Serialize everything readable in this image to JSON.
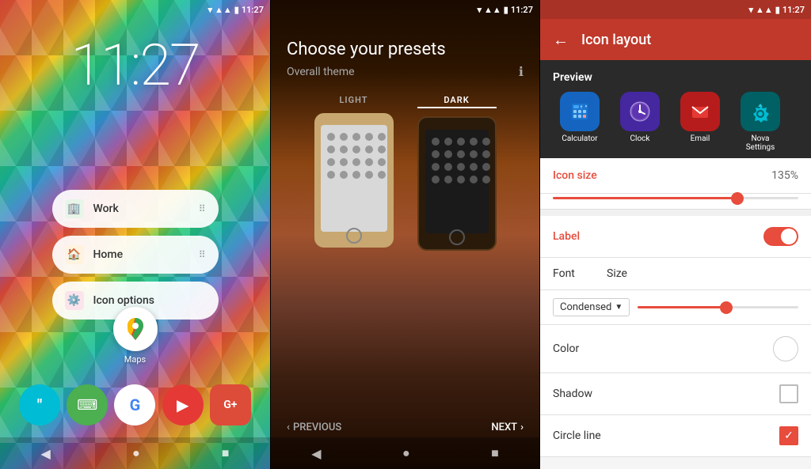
{
  "panel1": {
    "status_time": "11:27",
    "clock_time": "11:27",
    "menu_items": [
      {
        "label": "Work",
        "icon": "🏢",
        "icon_color": "#27ae60"
      },
      {
        "label": "Home",
        "icon": "🏠",
        "icon_color": "#e67e22"
      },
      {
        "label": "Icon options",
        "icon": "⚙️",
        "icon_color": "#e74c3c"
      }
    ],
    "maps_label": "Maps",
    "dock_icons": [
      "💬",
      "⌨",
      "G",
      "▶",
      "G+"
    ],
    "nav": {
      "back": "◀",
      "home": "●",
      "recents": "■"
    }
  },
  "panel2": {
    "status_time": "11:27",
    "title": "Choose your presets",
    "subtitle": "Overall theme",
    "light_label": "LIGHT",
    "dark_label": "DARK",
    "prev_label": "PREVIOUS",
    "next_label": "NEXT",
    "nav": {
      "back": "◀",
      "home": "●",
      "recents": "■"
    }
  },
  "panel3": {
    "status_time": "11:27",
    "header_title": "Icon layout",
    "back_icon": "←",
    "preview_label": "Preview",
    "preview_icons": [
      {
        "name": "Calculator",
        "color": "#2196F3",
        "bg": "#1565C0"
      },
      {
        "name": "Clock",
        "color": "#7E57C2",
        "bg": "#4527A0"
      },
      {
        "name": "Email",
        "color": "#E53935",
        "bg": "#B71C1C"
      },
      {
        "name": "Nova Settings",
        "color": "#00BCD4",
        "bg": "#006064"
      }
    ],
    "icon_size_label": "Icon size",
    "icon_size_value": "135%",
    "icon_size_percent": 75,
    "label_label": "Label",
    "font_label": "Font",
    "size_label": "Size",
    "condensed_label": "Condensed",
    "color_label": "Color",
    "shadow_label": "Shadow",
    "circle_line_label": "Circle line",
    "nav": {
      "back": "◀",
      "home": "●",
      "recents": "■"
    }
  }
}
